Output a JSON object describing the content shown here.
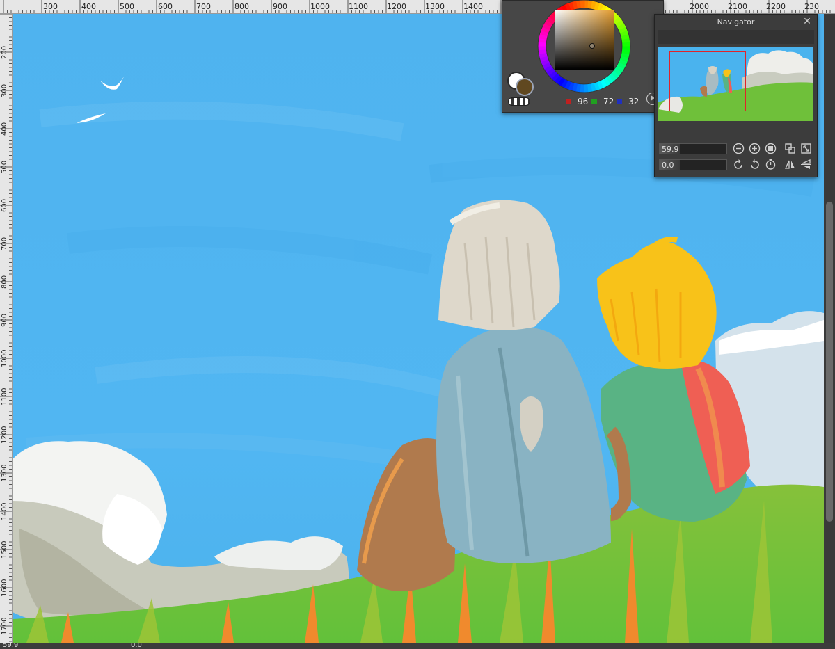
{
  "ruler": {
    "top_labels": [
      "300",
      "400",
      "500",
      "600",
      "700",
      "800",
      "900",
      "1000",
      "1100",
      "1200",
      "1300",
      "1400",
      "2000",
      "2100",
      "2200",
      "230"
    ],
    "left_labels": [
      "200",
      "300",
      "400",
      "500",
      "600",
      "700",
      "800",
      "900",
      "1000",
      "1100",
      "1200",
      "1300",
      "1400",
      "1500",
      "1600",
      "1700"
    ]
  },
  "color_panel": {
    "red_value": "96",
    "green_value": "72",
    "blue_value": "32",
    "current_color": "#604820",
    "foreground_color": "#ffffff",
    "hue_color": "#e39b2c"
  },
  "navigator": {
    "title": "Navigator",
    "minimize_icon": "minimize-icon",
    "close_icon": "close-icon",
    "zoom_value": "59.9",
    "rotate_value": "0.0",
    "zoom_level": 0.3,
    "rotate_level": 0.3,
    "zoom_buttons": [
      "zoom-out-icon",
      "zoom-in-icon",
      "stop-icon",
      "fit-icon",
      "fullscreen-icon"
    ],
    "rotate_buttons": [
      "rotate-left-icon",
      "rotate-right-icon",
      "reset-rotate-icon",
      "flip-horizontal-icon",
      "flip-vertical-icon"
    ]
  },
  "status_bar": {
    "zoom_text": "59.9",
    "angle_text": "0.0"
  }
}
